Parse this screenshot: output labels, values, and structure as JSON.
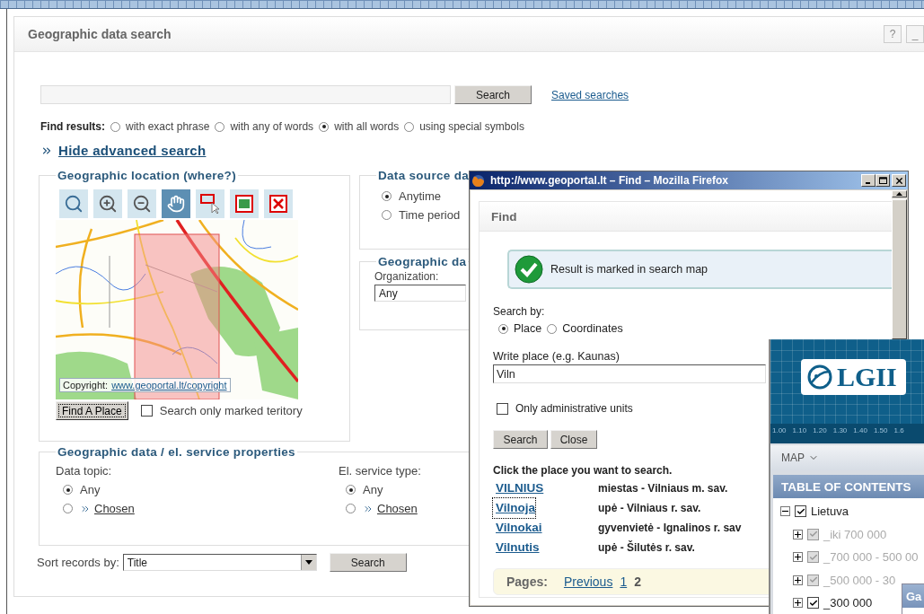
{
  "panel": {
    "title": "Geographic data search",
    "header_buttons": [
      "?",
      "_"
    ]
  },
  "search": {
    "button": "Search",
    "saved_link": "Saved searches"
  },
  "find_results": {
    "label": "Find results:",
    "options": [
      {
        "label": "with exact phrase",
        "selected": false
      },
      {
        "label": "with any of words",
        "selected": false
      },
      {
        "label": "with all words",
        "selected": true
      },
      {
        "label": "using special symbols",
        "selected": false
      }
    ]
  },
  "advanced_toggle": {
    "label": "Hide advanced search"
  },
  "location": {
    "title": "Geographic location (where?)",
    "tools": [
      {
        "kind": "globe",
        "selected": false
      },
      {
        "kind": "zoom-in",
        "selected": false
      },
      {
        "kind": "zoom-out",
        "selected": false
      },
      {
        "kind": "pan",
        "selected": true
      },
      {
        "kind": "select",
        "selected": false
      },
      {
        "kind": "extent",
        "selected": false
      },
      {
        "kind": "clear",
        "selected": false
      }
    ],
    "copyright_label": "Copyright:",
    "copyright_link": "www.geoportal.lt/copyright",
    "find_button": "Find A Place",
    "marked_only": {
      "label": "Search only marked teritory",
      "checked": false
    }
  },
  "date": {
    "title": "Data source da",
    "options": [
      {
        "label": "Anytime",
        "selected": true
      },
      {
        "label": "Time period",
        "selected": false
      }
    ]
  },
  "geo_data": {
    "title": "Geographic da",
    "org_label": "Organization:",
    "org_value": "Any"
  },
  "properties": {
    "title": "Geographic data / el. service properties",
    "groups": [
      {
        "label": "Data topic:",
        "options": [
          {
            "label": "Any",
            "selected": true,
            "kind": "plain"
          },
          {
            "label": "Chosen",
            "selected": false,
            "kind": "link"
          }
        ]
      },
      {
        "label": "El. service type:",
        "options": [
          {
            "label": "Any",
            "selected": true,
            "kind": "plain"
          },
          {
            "label": "Chosen",
            "selected": false,
            "kind": "link"
          }
        ]
      }
    ]
  },
  "sort": {
    "label": "Sort records by:",
    "value": "Title",
    "button": "Search"
  },
  "popup": {
    "title": "http://www.geoportal.lt – Find – Mozilla Firefox",
    "heading": "Find",
    "message": "Result is marked in search map",
    "search_by": {
      "label": "Search by:",
      "options": [
        {
          "label": "Place",
          "selected": true
        },
        {
          "label": "Coordinates",
          "selected": false
        }
      ]
    },
    "place_label": "Write place (e.g. Kaunas)",
    "place_value": "Viln",
    "admin_only": {
      "label": "Only administrative units",
      "checked": false
    },
    "buttons": [
      "Search",
      "Close"
    ],
    "results_heading": "Click the place you want to search.",
    "results": [
      {
        "name": "VILNIUS",
        "info": "miestas - Vilniaus m. sav.",
        "focused": false
      },
      {
        "name": "Vilnoja",
        "info": "upė - Vilniaus r. sav.",
        "focused": true
      },
      {
        "name": "Vilnokai",
        "info": "gyvenvietė - Ignalinos r. sav",
        "focused": false
      },
      {
        "name": "Vilnutis",
        "info": "upė - Šilutės r. sav.",
        "focused": false
      }
    ],
    "pages": {
      "label": "Pages:",
      "links": [
        {
          "label": "Previous",
          "kind": "link"
        },
        {
          "label": "1",
          "kind": "link"
        },
        {
          "label": "2",
          "kind": "current"
        }
      ]
    }
  },
  "lgii": {
    "logo": "LGII",
    "scale": [
      "1.00",
      "1.10",
      "1.20",
      "1.30",
      "1.40",
      "1.50",
      "1.6"
    ],
    "menu": "MAP",
    "toc_title": "TABLE OF CONTENTS",
    "tree": [
      {
        "label": "Lietuva",
        "checked": true,
        "expanded": true,
        "disabled": false,
        "children": [
          {
            "label": "_iki 700 000",
            "checked": true,
            "expanded": false,
            "disabled": true
          },
          {
            "label": "_700 000 - 500 00",
            "checked": true,
            "expanded": false,
            "disabled": true
          },
          {
            "label": "_500 000 - 30",
            "checked": true,
            "expanded": false,
            "disabled": true
          },
          {
            "label": "_300 000",
            "checked": true,
            "expanded": false,
            "disabled": false
          }
        ]
      }
    ]
  },
  "mini_window": {
    "title": "Ga"
  }
}
